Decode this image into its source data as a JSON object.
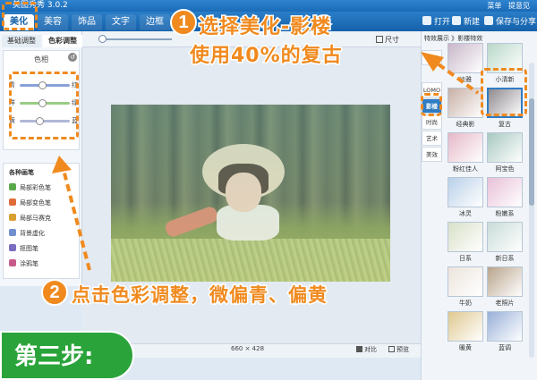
{
  "window": {
    "title": "美图秀秀 3.0.2",
    "right_links": [
      "菜单",
      "提意见"
    ]
  },
  "menu": {
    "tabs": [
      "美化",
      "美容",
      "饰品",
      "文字",
      "边框"
    ],
    "active_tab": "美化",
    "actions": [
      "打开",
      "新建",
      "保存与分享"
    ]
  },
  "toolbar": {
    "left_label": "原图",
    "size_label": "尺寸"
  },
  "left_panel": {
    "tabs": [
      "基础调整",
      "色彩调整"
    ],
    "active_tab": "色彩调整",
    "color_section_title": "色相",
    "sliders": [
      {
        "left": "青",
        "right": "红",
        "value": 0.45,
        "color": "#8aa0d8"
      },
      {
        "left": "洋",
        "right": "绿",
        "value": 0.45,
        "color": "#9acd84"
      },
      {
        "left": "黄",
        "right": "蓝",
        "value": 0.4,
        "color": "#b0b8d8"
      }
    ],
    "brush_section_title": "各种画笔",
    "brushes": [
      {
        "label": "局部彩色笔",
        "color": "#5aa84a"
      },
      {
        "label": "局部变色笔",
        "color": "#e06c3c"
      },
      {
        "label": "局部马赛克",
        "color": "#d8a030"
      },
      {
        "label": "背景虚化",
        "color": "#6f8fd0"
      },
      {
        "label": "抠图笔",
        "color": "#7c6cc0"
      },
      {
        "label": "涂鸦笔",
        "color": "#c85a8a"
      }
    ]
  },
  "status": {
    "image_size": "660 × 428",
    "compare": "对比",
    "preview": "预览"
  },
  "right_panel": {
    "header": "特效展示 》影楼特效",
    "categories": [
      "热门",
      "LOMO",
      "影楼",
      "时尚",
      "艺术",
      "美效"
    ],
    "active_category": "影楼",
    "effects": [
      {
        "label": "淡雅",
        "color": "#c9b7c9"
      },
      {
        "label": "小清新",
        "color": "#b9d8c9"
      },
      {
        "label": "经典影",
        "color": "#c7b0a6"
      },
      {
        "label": "复古",
        "color": "#8f8a8f"
      },
      {
        "label": "粉红佳人",
        "color": "#e6b8c8"
      },
      {
        "label": "阿宝色",
        "color": "#a8c8c0"
      },
      {
        "label": "冰灵",
        "color": "#b8d0e8"
      },
      {
        "label": "粉嫩系",
        "color": "#e8c0d8"
      },
      {
        "label": "日系",
        "color": "#d8e0c8"
      },
      {
        "label": "新日系",
        "color": "#c8dcd8"
      },
      {
        "label": "牛奶",
        "color": "#ece4dc"
      },
      {
        "label": "老照片",
        "color": "#b8a48c"
      },
      {
        "label": "暖黄",
        "color": "#e0c890"
      },
      {
        "label": "蓝调",
        "color": "#98b0d8"
      }
    ],
    "selected_effect": "复古"
  },
  "tutorial": {
    "step1_number": "1",
    "step1_line1": "选择美化-影楼",
    "step1_line2": "使用40%的复古",
    "step2_number": "2",
    "step2_text": "点击色彩调整，微偏青、偏黄",
    "step_banner": "第三步:",
    "accent_color": "#f08a1f"
  }
}
